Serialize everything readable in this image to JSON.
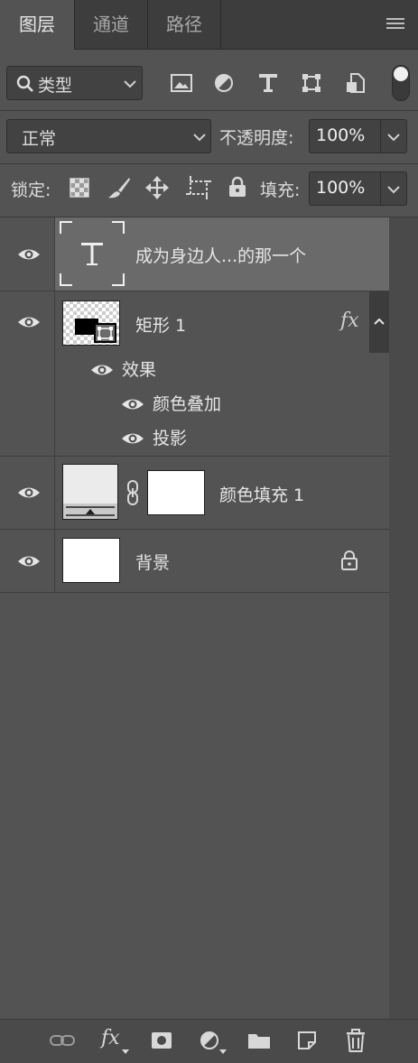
{
  "tabs": [
    "图层",
    "通道",
    "路径"
  ],
  "filter": {
    "label": "类型"
  },
  "blend": {
    "mode": "正常",
    "opacity_label": "不透明度:",
    "opacity": "100%"
  },
  "lock": {
    "label": "锁定:",
    "fill_label": "填充:",
    "fill": "100%"
  },
  "layers": [
    {
      "name": "成为身边人...的那一个",
      "type": "text",
      "selected": true
    },
    {
      "name": "矩形 1",
      "type": "shape",
      "fx": "fx",
      "effects_label": "效果",
      "effects": [
        "颜色叠加",
        "投影"
      ]
    },
    {
      "name": "颜色填充 1",
      "type": "fill"
    },
    {
      "name": "背景",
      "type": "background",
      "locked": true
    }
  ],
  "bottom": {
    "fx": "fx"
  }
}
